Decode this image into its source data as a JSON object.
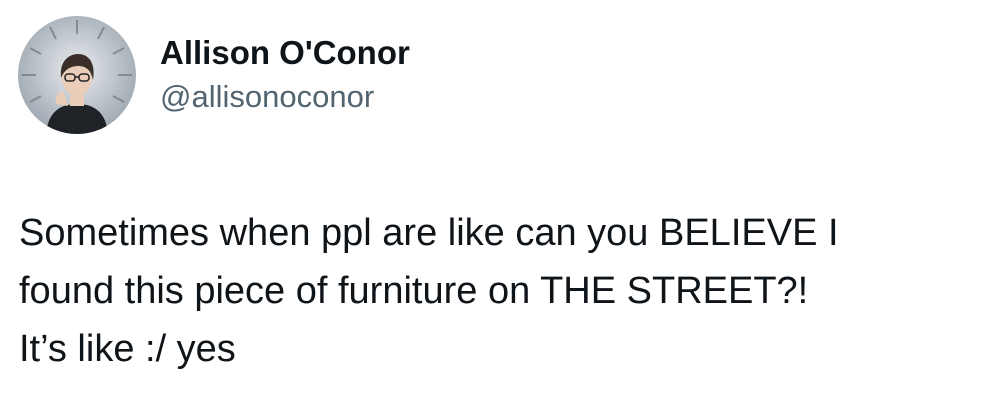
{
  "author": {
    "display_name": "Allison O'Conor",
    "handle": "@allisonoconor",
    "avatar_icon": "profile-photo"
  },
  "tweet": {
    "lines": [
      "Sometimes when ppl are like can you BELIEVE I",
      "found this piece of furniture on THE STREET?!",
      "It’s like :/ yes"
    ]
  },
  "colors": {
    "text": "#0f1419",
    "handle": "#536471",
    "background": "#ffffff"
  }
}
